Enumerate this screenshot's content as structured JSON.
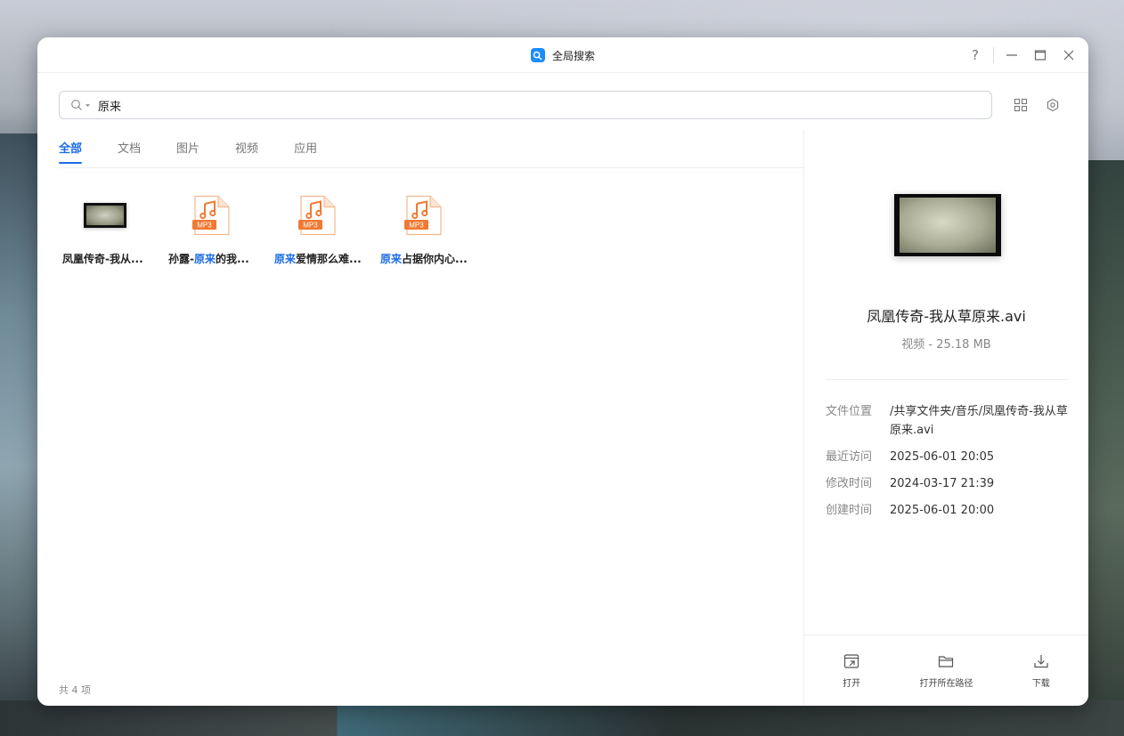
{
  "window": {
    "title": "全局搜索"
  },
  "search": {
    "value": "原来"
  },
  "tabs": [
    "全部",
    "文档",
    "图片",
    "视频",
    "应用"
  ],
  "files": [
    {
      "type": "video",
      "name_plain": "凤凰传奇-我从...",
      "name_parts": [
        "凤凰传奇-我从..."
      ]
    },
    {
      "type": "mp3",
      "name_parts": [
        "孙露-",
        "原来",
        "的我..."
      ],
      "badge": "MP3"
    },
    {
      "type": "mp3",
      "name_parts": [
        "原来",
        "爱情那么难..."
      ],
      "badge": "MP3"
    },
    {
      "type": "mp3",
      "name_parts": [
        "原来",
        "占据你内心..."
      ],
      "badge": "MP3"
    }
  ],
  "footer": {
    "count": "共 4 项"
  },
  "detail": {
    "name": "凤凰传奇-我从草原来.avi",
    "meta": "视频 - 25.18 MB",
    "props": [
      {
        "key": "文件位置",
        "value": "/共享文件夹/音乐/凤凰传奇-我从草原来.avi"
      },
      {
        "key": "最近访问",
        "value": "2025-06-01 20:05"
      },
      {
        "key": "修改时间",
        "value": "2024-03-17 21:39"
      },
      {
        "key": "创建时间",
        "value": "2025-06-01 20:00"
      }
    ],
    "actions": {
      "open": "打开",
      "open_path": "打开所在路径",
      "download": "下载"
    }
  },
  "colors": {
    "accent": "#1a6ce8",
    "mp3": "#f07a34"
  },
  "icons": [
    "search-icon",
    "help-icon",
    "minimize-icon",
    "maximize-icon",
    "close-icon",
    "grid-view-icon",
    "settings-icon",
    "open-icon",
    "folder-icon",
    "download-icon"
  ]
}
